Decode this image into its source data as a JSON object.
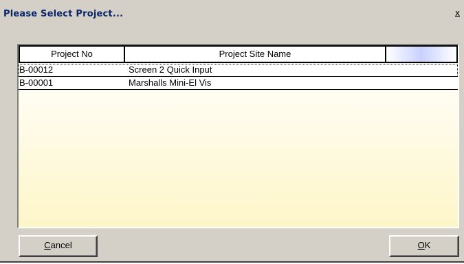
{
  "dialog": {
    "title": "Please Select Project...",
    "close_glyph": "x"
  },
  "table": {
    "columns": [
      "Project No",
      "Project Site Name",
      ""
    ],
    "rows": [
      {
        "project_no": "B-00012",
        "site_name": "Screen 2 Quick Input"
      },
      {
        "project_no": "B-00001",
        "site_name": "Marshalls Mini-El Vis"
      }
    ]
  },
  "buttons": {
    "cancel_label": "Cancel",
    "ok_label": "OK"
  },
  "colors": {
    "title_text": "#0a246a",
    "dialog_face": "#d4d0c8",
    "list_gradient_end": "#fdf6c8"
  }
}
